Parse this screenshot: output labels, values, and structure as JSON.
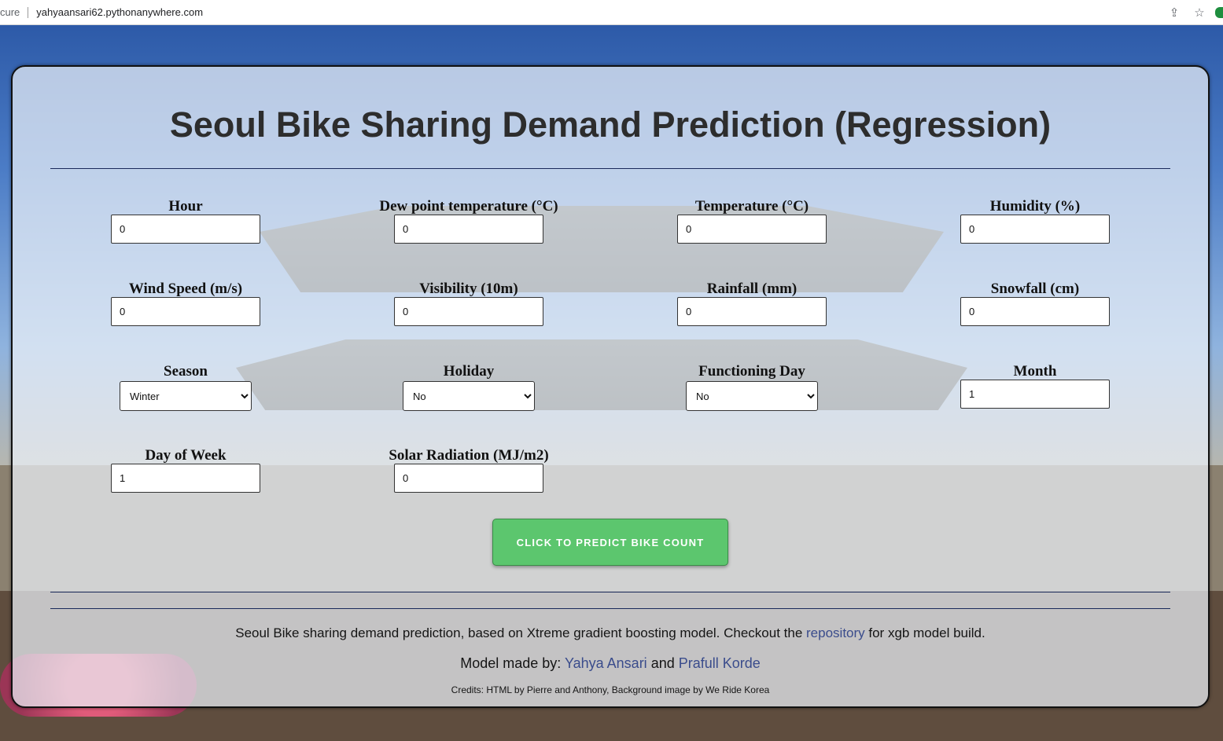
{
  "browser": {
    "secure_label": "cure",
    "url": "yahyaansari62.pythonanywhere.com"
  },
  "page": {
    "title": "Seoul Bike Sharing Demand Prediction (Regression)"
  },
  "form": {
    "hour": {
      "label": "Hour",
      "value": "0"
    },
    "dew_point": {
      "label": "Dew point temperature (°C)",
      "value": "0"
    },
    "temperature": {
      "label": "Temperature (°C)",
      "value": "0"
    },
    "humidity": {
      "label": "Humidity (%)",
      "value": "0"
    },
    "wind_speed": {
      "label": "Wind Speed (m/s)",
      "value": "0"
    },
    "visibility": {
      "label": "Visibility (10m)",
      "value": "0"
    },
    "rainfall": {
      "label": "Rainfall (mm)",
      "value": "0"
    },
    "snowfall": {
      "label": "Snowfall (cm)",
      "value": "0"
    },
    "season": {
      "label": "Season",
      "value": "Winter"
    },
    "holiday": {
      "label": "Holiday",
      "value": "No"
    },
    "functioning_day": {
      "label": "Functioning Day",
      "value": "No"
    },
    "month": {
      "label": "Month",
      "value": "1"
    },
    "day_of_week": {
      "label": "Day of Week",
      "value": "1"
    },
    "solar_radiation": {
      "label": "Solar Radiation (MJ/m2)",
      "value": "0"
    },
    "predict_button": "CLICK TO PREDICT BIKE COUNT"
  },
  "footer": {
    "desc_before": "Seoul Bike sharing demand prediction, based on Xtreme gradient boosting model. Checkout the ",
    "repo_link": "repository",
    "desc_after": " for xgb model build.",
    "made_by": "Model made by: ",
    "author1": "Yahya Ansari",
    "and": " and ",
    "author2": "Prafull Korde",
    "credits": "Credits: HTML by Pierre and Anthony, Background image by We Ride Korea"
  }
}
